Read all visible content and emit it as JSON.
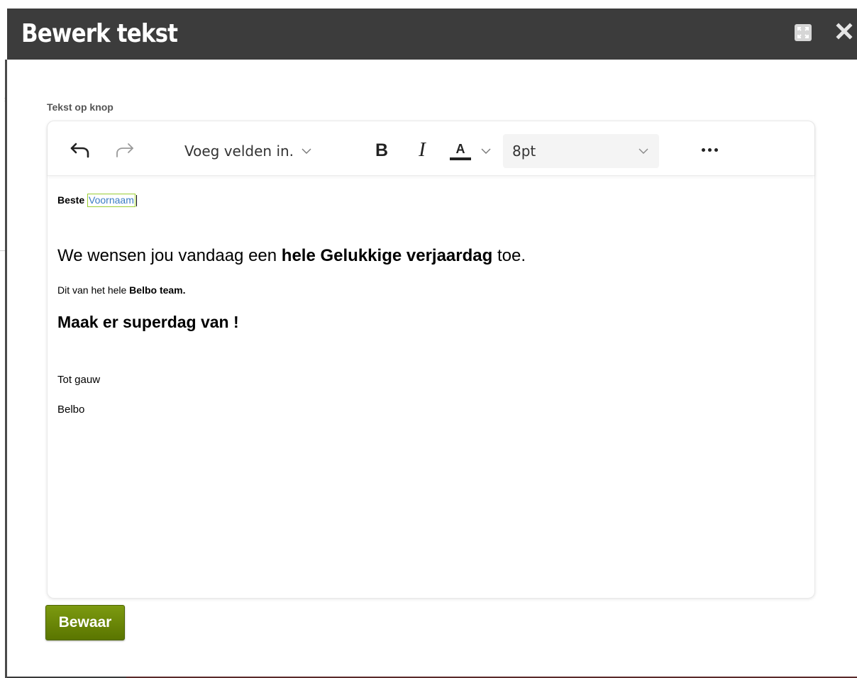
{
  "dialog": {
    "title": "Bewerk tekst",
    "maximize_icon": "expand-icon",
    "close_icon": "close-icon"
  },
  "field": {
    "label": "Tekst op knop"
  },
  "toolbar": {
    "undo_icon": "undo-icon",
    "redo_icon": "redo-icon",
    "insert_fields_label": "Voeg velden in.",
    "bold_label": "B",
    "italic_label": "I",
    "font_color_label": "A",
    "font_size_value": "8pt",
    "more_icon": "more-icon"
  },
  "content": {
    "greeting": "Beste",
    "merge_field": "Voornaam",
    "wish_prefix": "We wensen jou vandaag een ",
    "wish_bold": "hele Gelukkige verjaardag",
    "wish_suffix": " toe.",
    "team_prefix": "Dit van het hele ",
    "team_bold": "Belbo team.",
    "make_it": "Maak er superdag van !",
    "closing": "Tot gauw",
    "signature": "Belbo"
  },
  "actions": {
    "save_label": "Bewaar"
  },
  "colors": {
    "titlebar": "#3c3c3c",
    "save_button": "#6a8a06",
    "merge_field_border": "#9acd32",
    "merge_field_text": "#3b7dc4"
  }
}
